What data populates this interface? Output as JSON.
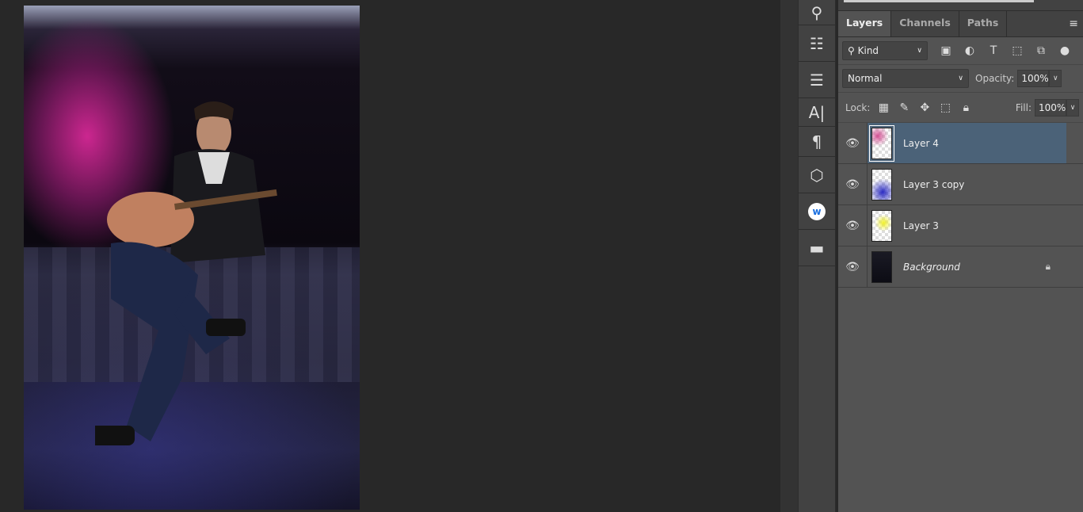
{
  "panel": {
    "tabs": [
      "Layers",
      "Channels",
      "Paths"
    ],
    "filter": "Kind",
    "blend_mode": "Normal",
    "opacity_label": "Opacity:",
    "opacity": "100%",
    "lock_label": "Lock:",
    "fill_label": "Fill:",
    "fill": "100%"
  },
  "layers": [
    {
      "name": "Layer 4",
      "selected": true,
      "visible": true,
      "thumb_color": "#d0408a"
    },
    {
      "name": "Layer 3 copy",
      "selected": false,
      "visible": true,
      "thumb_color": "#2020c0"
    },
    {
      "name": "Layer 3",
      "selected": false,
      "visible": true,
      "thumb_color": "#f0f020"
    },
    {
      "name": "Background",
      "selected": false,
      "visible": true,
      "locked": true
    }
  ],
  "colors": {
    "selection": "#4b6278",
    "panel": "#535353",
    "canvas": "#282828"
  }
}
